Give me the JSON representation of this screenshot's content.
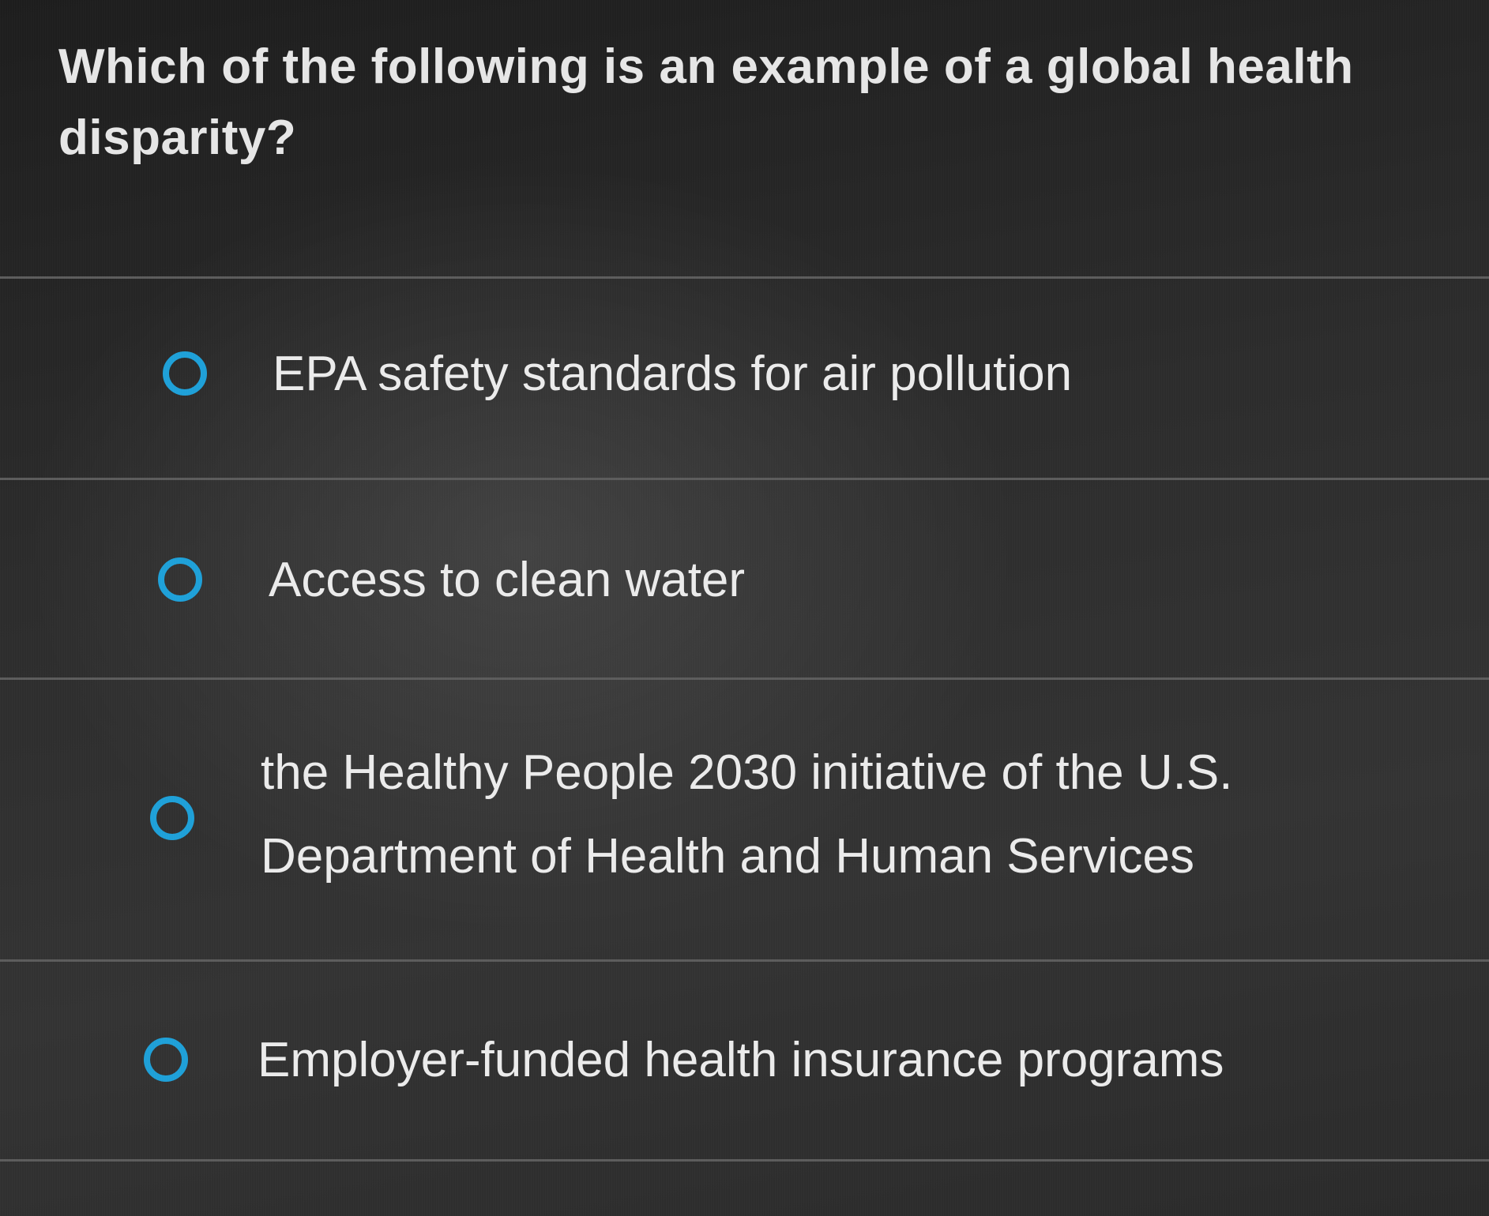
{
  "question": {
    "text": "Which of the following is an example of a global health disparity?"
  },
  "options": [
    {
      "label": "EPA safety standards for air pollution"
    },
    {
      "label": "Access to clean water"
    },
    {
      "label": "the Healthy People 2030 initiative of the U.S. Department of Health and Human Services"
    },
    {
      "label": "Employer-funded health insurance programs"
    }
  ],
  "colors": {
    "radio_ring": "#1ea0d8",
    "background": "#2a2a2a",
    "text": "#ebebeb"
  },
  "icons": {
    "radio": "radio-unselected-icon"
  }
}
